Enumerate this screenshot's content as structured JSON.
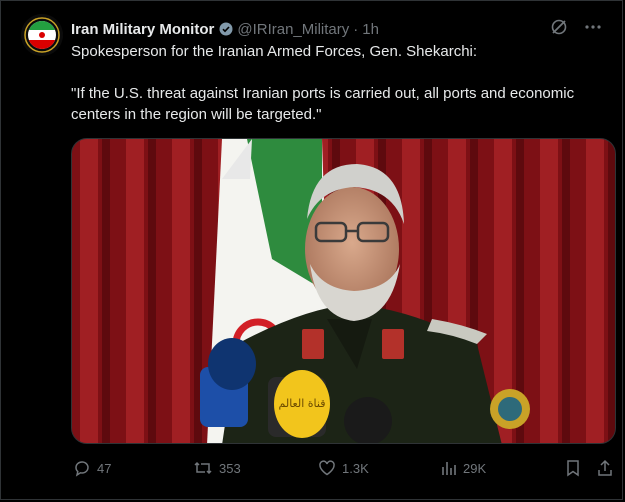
{
  "account": {
    "name": "Iran Military Monitor",
    "handle": "@IRIran_Military",
    "separator": "·",
    "time": "1h",
    "avatar_icon": "iran-flag-emblem-icon",
    "badge_icon": "verified-badge-icon"
  },
  "tweet": {
    "line1": "Spokesperson for the Iranian Armed Forces, Gen. Shekarchi:",
    "line2": "\"If the U.S. threat against Iranian ports is carried out, all ports and economic centers in the region will be targeted.\""
  },
  "media": {
    "subject": "photo-of-general-speaking-at-microphones",
    "mic_labels": [
      "قناة العالم"
    ]
  },
  "actions": {
    "replies": "47",
    "reposts": "353",
    "likes": "1.3K",
    "views": "29K"
  },
  "colors": {
    "background": "#000000",
    "text": "#e7e9ea",
    "secondary": "#71767b",
    "border": "#2f3336"
  }
}
